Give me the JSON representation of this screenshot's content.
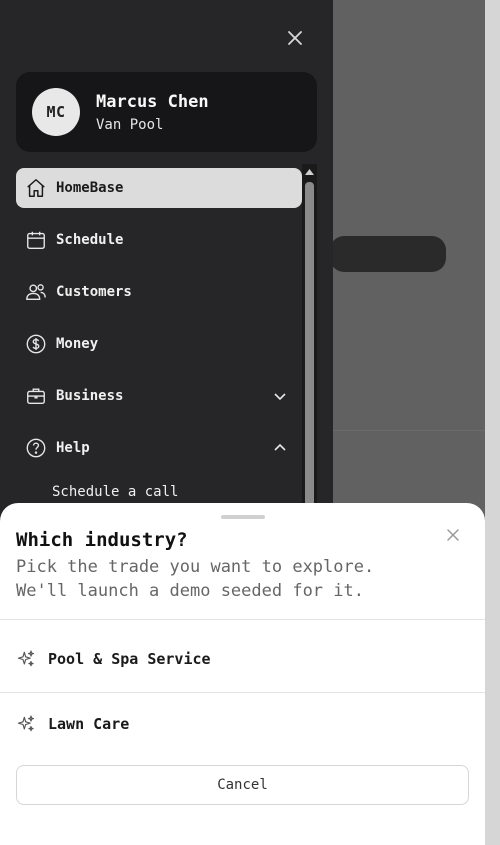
{
  "profile": {
    "initials": "MC",
    "name": "Marcus Chen",
    "subtitle": "Van Pool"
  },
  "nav": {
    "items": [
      {
        "label": "HomeBase",
        "icon": "home-icon",
        "active": true
      },
      {
        "label": "Schedule",
        "icon": "calendar-icon"
      },
      {
        "label": "Customers",
        "icon": "users-icon"
      },
      {
        "label": "Money",
        "icon": "dollar-icon"
      },
      {
        "label": "Business",
        "icon": "briefcase-icon",
        "expandable": true,
        "expanded": false
      },
      {
        "label": "Help",
        "icon": "help-icon",
        "expandable": true,
        "expanded": true
      }
    ],
    "help_sub": {
      "label": "Schedule a call"
    }
  },
  "sheet": {
    "title": "Which industry?",
    "description": "Pick the trade you want to explore. We'll launch a demo seeded for it.",
    "options": [
      {
        "label": "Pool & Spa Service",
        "icon": "sparkles-icon"
      },
      {
        "label": "Lawn Care",
        "icon": "sparkles-icon"
      }
    ],
    "cancel_label": "Cancel"
  },
  "colors": {
    "drawer_bg": "#262628",
    "active_item_bg": "#dcdcdc",
    "sheet_bg": "#ffffff",
    "overlay": "#616161"
  }
}
